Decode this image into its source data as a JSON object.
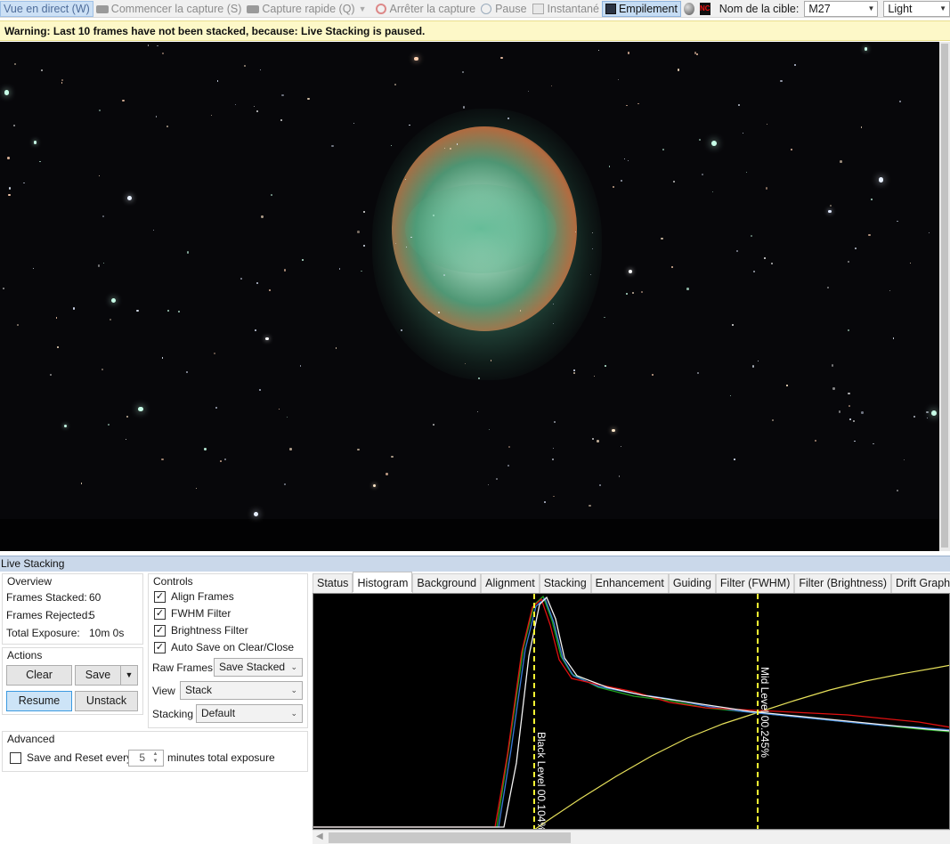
{
  "toolbar": {
    "live_view": "Vue en direct (W)",
    "start_capture": "Commencer la capture (S)",
    "quick_capture": "Capture rapide (Q)",
    "stop_capture": "Arrêter la capture",
    "pause": "Pause",
    "snapshot": "Instantané",
    "stacking": "Empilement",
    "target_label": "Nom de la cible:",
    "target_value": "M27",
    "frame_type": "Light",
    "nc_icon_text": "NC"
  },
  "warning": "Warning: Last 10 frames have not been stacked, because: Live Stacking is paused.",
  "panel": {
    "title": "Live Stacking",
    "overview": {
      "title": "Overview",
      "frames_stacked_label": "Frames Stacked:",
      "frames_stacked": "60",
      "frames_rejected_label": "Frames Rejected:",
      "frames_rejected": "5",
      "total_exposure_label": "Total Exposure:",
      "total_exposure": "10m 0s"
    },
    "actions": {
      "title": "Actions",
      "clear": "Clear",
      "save": "Save",
      "resume": "Resume",
      "unstack": "Unstack"
    },
    "controls": {
      "title": "Controls",
      "align_frames": "Align Frames",
      "fwhm_filter": "FWHM Filter",
      "brightness_filter": "Brightness Filter",
      "auto_save": "Auto Save on Clear/Close",
      "raw_frames_label": "Raw Frames",
      "raw_frames_value": "Save Stacked",
      "view_label": "View",
      "view_value": "Stack",
      "stacking_label": "Stacking",
      "stacking_value": "Default"
    },
    "advanced": {
      "title": "Advanced",
      "save_reset_label": "Save and Reset every",
      "minutes_value": "5",
      "minutes_suffix": "minutes total exposure"
    }
  },
  "tabs": [
    "Status",
    "Histogram",
    "Background",
    "Alignment",
    "Stacking",
    "Enhancement",
    "Guiding",
    "Filter (FWHM)",
    "Filter (Brightness)",
    "Drift Graph"
  ],
  "histogram": {
    "black_level_label": "Black Level",
    "black_level_value": "00.104%",
    "mid_level_label": "Mid Level",
    "mid_level_value": "00.245%",
    "colors": {
      "red": "#e01010",
      "green": "#1fa31f",
      "blue": "#3a7ad8",
      "white": "#f2f2f2",
      "curve": "#e6e05a",
      "marker": "#ffff33"
    }
  }
}
